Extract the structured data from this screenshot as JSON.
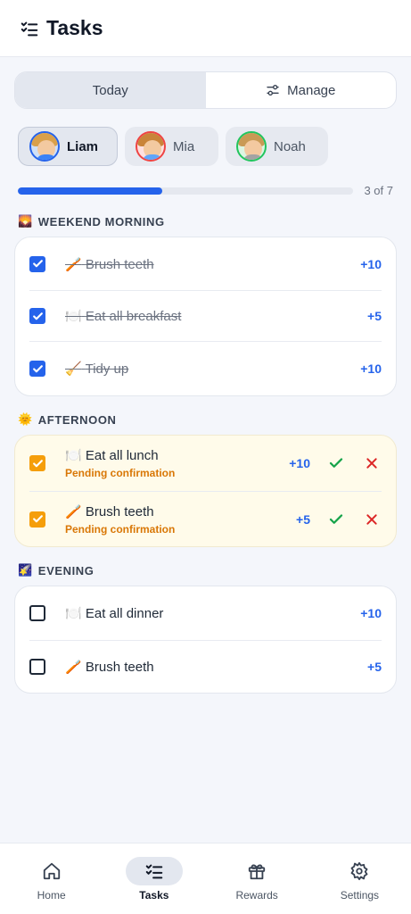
{
  "app": {
    "title": "Tasks"
  },
  "segments": {
    "today": "Today",
    "manage": "Manage",
    "active": "today"
  },
  "kids": [
    {
      "name": "Liam",
      "active": true,
      "ring": "#2563eb"
    },
    {
      "name": "Mia",
      "active": false,
      "ring": "#ef4444"
    },
    {
      "name": "Noah",
      "active": false,
      "ring": "#22c55e"
    }
  ],
  "progress": {
    "done": 3,
    "total": 7,
    "label": "3 of 7",
    "fraction": 0.43
  },
  "sections": [
    {
      "emoji": "🌄",
      "title": "WEEKEND MORNING",
      "tasks": [
        {
          "emoji": "🪥",
          "name": "Brush teeth",
          "points": "+10",
          "state": "done"
        },
        {
          "emoji": "🍽️",
          "name": "Eat all breakfast",
          "points": "+5",
          "state": "done"
        },
        {
          "emoji": "🧹",
          "name": "Tidy up",
          "points": "+10",
          "state": "done"
        }
      ]
    },
    {
      "emoji": "🌞",
      "title": "AFTERNOON",
      "tasks": [
        {
          "emoji": "🍽️",
          "name": "Eat all lunch",
          "points": "+10",
          "state": "pending",
          "status": "Pending confirmation"
        },
        {
          "emoji": "🪥",
          "name": "Brush teeth",
          "points": "+5",
          "state": "pending",
          "status": "Pending confirmation"
        }
      ]
    },
    {
      "emoji": "🌠",
      "title": "EVENING",
      "tasks": [
        {
          "emoji": "🍽️",
          "name": "Eat all dinner",
          "points": "+10",
          "state": "todo"
        },
        {
          "emoji": "🪥",
          "name": "Brush teeth",
          "points": "+5",
          "state": "todo"
        }
      ]
    }
  ],
  "nav": [
    {
      "label": "Home",
      "icon": "home-icon",
      "active": false
    },
    {
      "label": "Tasks",
      "icon": "tasks-icon",
      "active": true
    },
    {
      "label": "Rewards",
      "icon": "gift-icon",
      "active": false
    },
    {
      "label": "Settings",
      "icon": "gear-icon",
      "active": false
    }
  ],
  "colors": {
    "accent": "#2563eb",
    "pending": "#f59e0b",
    "confirm": "#16a34a",
    "reject": "#dc2626"
  }
}
